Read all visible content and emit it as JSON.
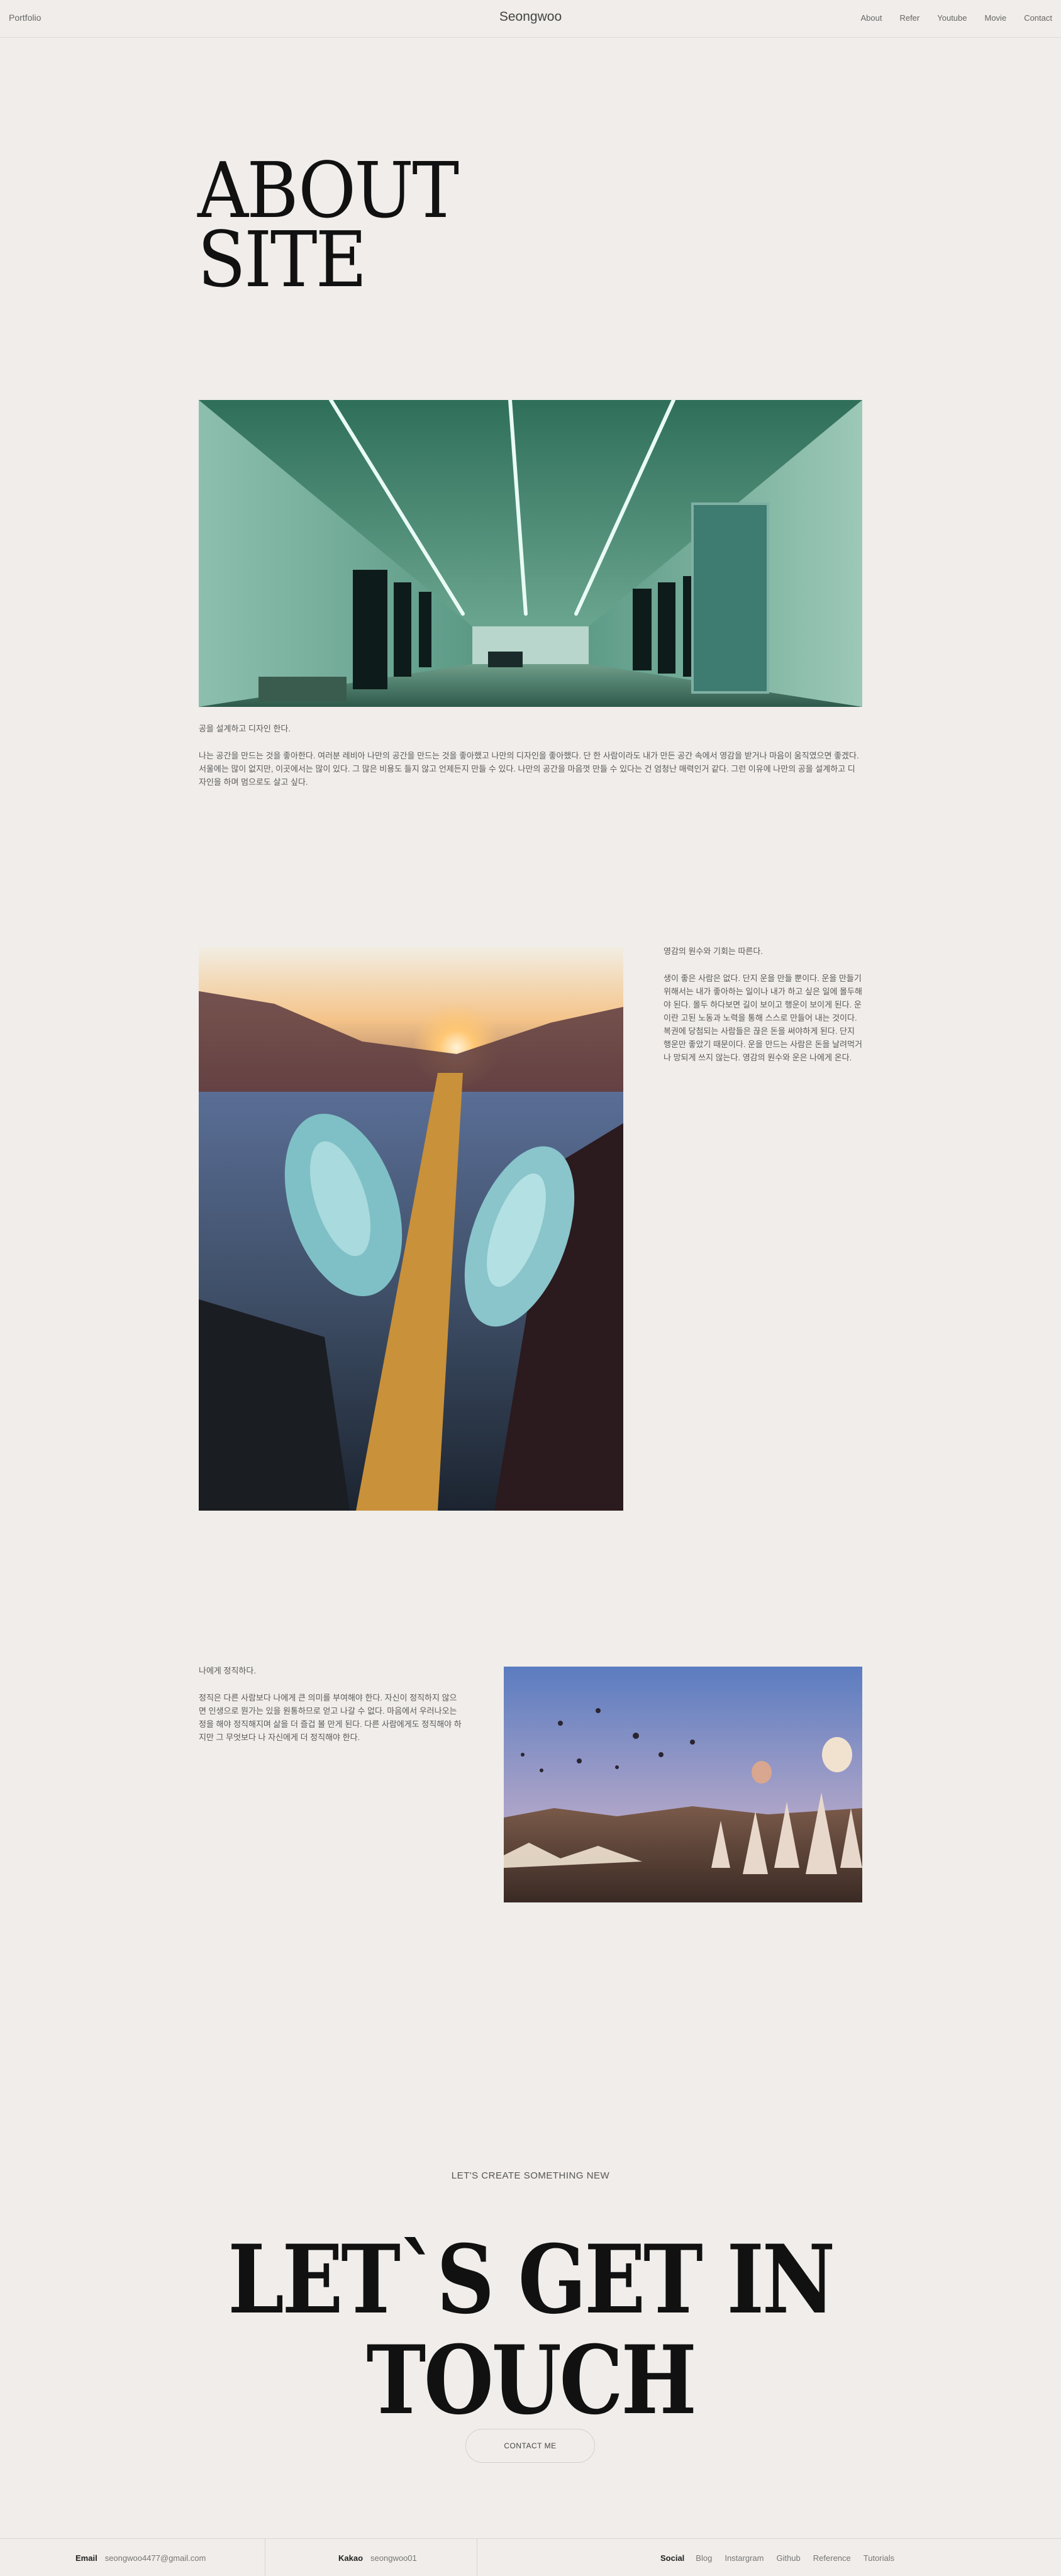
{
  "header": {
    "left_label": "Portfolio",
    "site_name": "Seongwoo",
    "nav": [
      "About",
      "Refer",
      "Youtube",
      "Movie",
      "Contact"
    ]
  },
  "hero": {
    "line1": "ABOUT",
    "line2": "SITE"
  },
  "section1": {
    "lead": "공을 설계하고 디자인 한다.",
    "body": "나는 공간을 만드는 것을 좋아한다. 여러분 레비아 나만의 공간을 만드는 것을 좋아했고 나만의 디자인을 좋아했다. 단 한 사람이라도 내가 만든 공간 속에서 영감을 받거나 마음이 움직였으면 좋겠다. 서울에는 많이 없지만, 이곳에서는 많이 있다. 그 많은 비용도 들지 않고 언제든지 만들 수 있다. 나만의 공간을 마음껏 만들 수 있다는 건 엄청난 매력인거 같다. 그런 이유에 나만의 공을 설계하고 디자인을 하며 멈으로도 살고 싶다."
  },
  "section2": {
    "lead": "영감의 원수와 기회는 따른다.",
    "body": "생이 좋은 사람은 없다. 단지 운을 만들 뿐이다. 운을 만들기 위해서는 내가 좋아하는 일이나 내가 하고 싶은 일에 몰두해야 된다. 몰두 하다보면 길이 보이고 행운이 보이게 된다. 운이란 고된 노동과 노력을 통해 스스로 만들어 내는 것이다. 복권에 당첨되는 사람들은 끊은 돈을 써야하게 된다. 단지 행운만 좋았기 때문이다. 운을 만드는 사람은 돈을 날려먹거나 망되게 쓰지 않는다. 영감의 원수와 운은 나에게 온다."
  },
  "section3": {
    "lead": "나에게 정직하다.",
    "body": "정직은 다른 사람보다 나에게 큰 의미를 부여해야 한다. 자신이 정직하지 않으면 인생으로 뭔가는 있을 원통하므로 얻고 나갈 수 없다. 마음에서 우러나오는 정을 해야 정직해지며 삶을 더 즐겁 볼 만게 된다. 다른 사람에게도 정직해야 하지만 그 무엇보다 나 자신에게 더 정직해야 한다."
  },
  "contact": {
    "kicker": "LET'S CREATE SOMETHING NEW",
    "title1": "LET`S GET IN",
    "title2": "TOUCH",
    "button": "CONTACT ME"
  },
  "footer": {
    "email_label": "Email",
    "email": "seongwoo4477@gmail.com",
    "kakao_label": "Kakao",
    "kakao": "seongwoo01",
    "social_label": "Social",
    "social_links": [
      "Blog",
      "Instargram",
      "Github",
      "Reference",
      "Tutorials"
    ]
  },
  "colors": {
    "background": "#f0edea",
    "text": "#111111",
    "border": "#d9d5d0"
  }
}
